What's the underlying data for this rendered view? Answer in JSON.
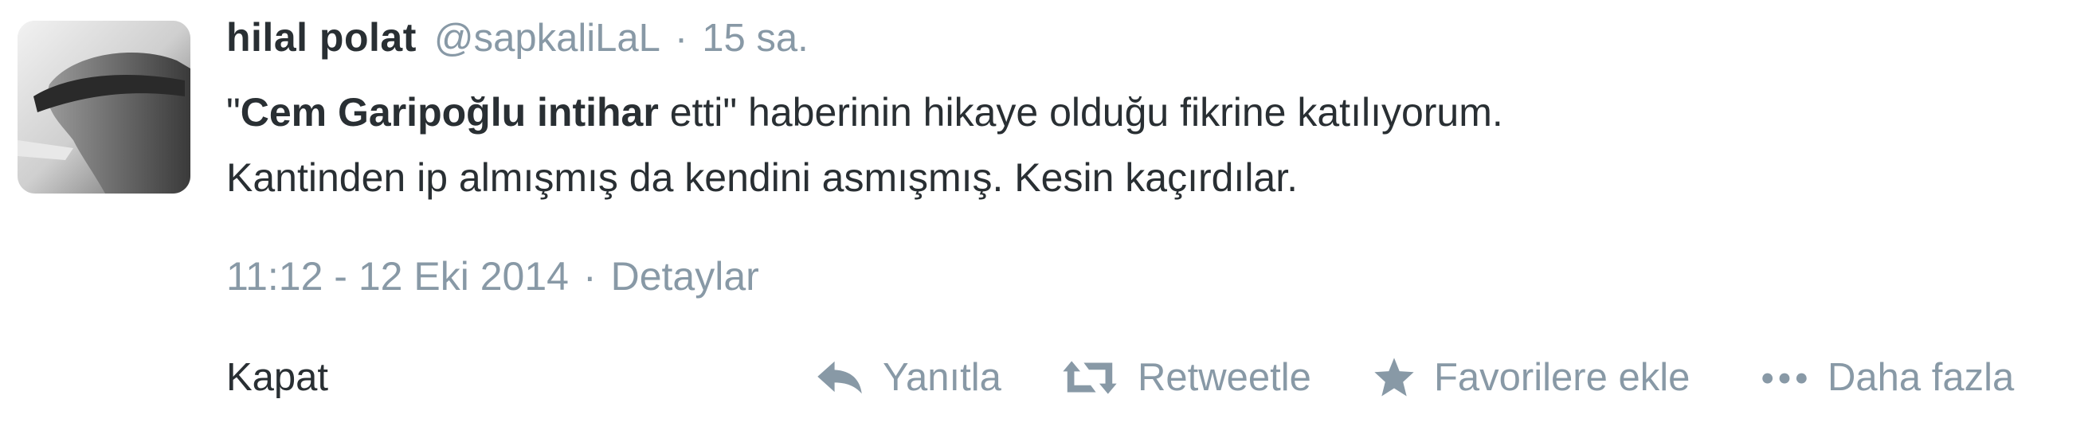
{
  "author": {
    "name": "hilal polat",
    "handle": "@sapkaliLaL",
    "separator": "·",
    "relative_time": "15 sa."
  },
  "tweet": {
    "line1": {
      "open_quote": "\"",
      "bold": "Cem Garipoğlu intihar",
      "rest": " etti\" haberinin hikaye olduğu fikrine katılıyorum."
    },
    "line2": "Kantinden ip almışmış da kendini asmışmış. Kesin kaçırdılar."
  },
  "meta": {
    "timestamp": "11:12 - 12 Eki 2014",
    "separator": "·",
    "details": "Detaylar"
  },
  "actions": {
    "close": "Kapat",
    "reply": {
      "label": "Yanıtla",
      "icon": "reply-icon"
    },
    "retweet": {
      "label": "Retweetle",
      "icon": "retweet-icon"
    },
    "favorite": {
      "label": "Favorilere ekle",
      "icon": "star-icon"
    },
    "more": {
      "label": "Daha fazla",
      "icon": "more-dots-icon"
    }
  },
  "colors": {
    "text": "#292f33",
    "muted": "#8899a6",
    "background": "#ffffff"
  }
}
